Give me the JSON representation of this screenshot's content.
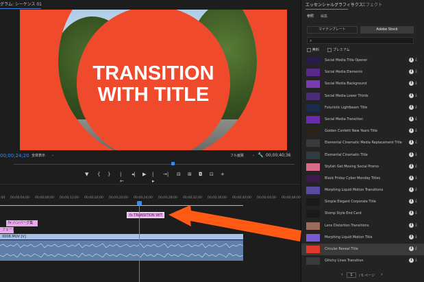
{
  "program": {
    "title": "グラム: シーケンス 01",
    "menu_icon": "≡",
    "video_title": "TRANSITION\nWITH TITLE",
    "timecode_current": "00;00;24;20",
    "fit_label": "全体表示",
    "quality_label": "フル画質",
    "timecode_total": "00;00;40;36",
    "transport": {
      "marker": "▼",
      "in_point": "{",
      "out_point": "}",
      "go_in": "|←",
      "step_back": "◂|",
      "play": "▶",
      "step_fwd": "|▸",
      "go_out": "→|",
      "lift": "⊟",
      "extract": "⊞",
      "export_frame": "◘",
      "compare": "⊡",
      "add": "+"
    }
  },
  "timeline": {
    "ruler_ticks": [
      "00;00;04;00",
      "00;00;08;00",
      "00;00;12;00",
      "00;00;16;00",
      "00;00;20;00",
      "00;00;24;00",
      "00;00;28;00",
      "00;00;32;00",
      "00;00;36;00",
      "00;00;40;00",
      "00;00;44;00",
      "00;00;48;00"
    ],
    "ruler_start": ";00",
    "clip_transition": "fx TRANSITION WIT",
    "clip_hamburg": "fx ハンバーグ集",
    "clip_small": "フェードン",
    "clip_video": "0008.MOV [V]"
  },
  "essential_graphics": {
    "title": "エッセンシャルグラフィックス",
    "menu_icon": "≡",
    "effects_tab": "エフェクト",
    "tab_browse": "参照",
    "tab_edit": "編集",
    "btn_my_templates": "マイテンプレート",
    "btn_adobe_stock": "Adobe Stock",
    "search_icon": "⌕",
    "free_label": "無料",
    "premium_label": "プレミアム",
    "items": [
      {
        "name": "Social Media Title Opener",
        "thumb": "#2a1c4a"
      },
      {
        "name": "Social Media Elements",
        "thumb": "#5a2a8a"
      },
      {
        "name": "Social Media Background",
        "thumb": "#7a3ab0"
      },
      {
        "name": "Social Media Lower Thirds",
        "thumb": "#4a2a7a"
      },
      {
        "name": "Futuristic Lightbeam Title",
        "thumb": "#1a2a4a"
      },
      {
        "name": "Social Media Transition",
        "thumb": "#6a2ab0"
      },
      {
        "name": "Golden Confetti New Years Title",
        "thumb": "#2a2418"
      },
      {
        "name": "Elemental Cinematic Media Replacement Title",
        "thumb": "#3a3a3a"
      },
      {
        "name": "Elemental Cinematic Title",
        "thumb": "#2f3a42"
      },
      {
        "name": "Stylish Get Moving Social Promo",
        "thumb": "#d86a8a"
      },
      {
        "name": "Black Friday Cyber Monday Titles",
        "thumb": "#3a1a4a"
      },
      {
        "name": "Morphing Liquid Motion Transitions",
        "thumb": "#5a4aa0"
      },
      {
        "name": "Simple Elegant Corporate Title",
        "thumb": "#1a1a1a"
      },
      {
        "name": "Stomp Style End Card",
        "thumb": "#1a1a1a"
      },
      {
        "name": "Lens Distortion Transitions",
        "thumb": "#9a6a5a"
      },
      {
        "name": "Morphing Liquid Motion Title",
        "thumb": "#7a5ad0"
      },
      {
        "name": "Circular Reveal Title",
        "thumb": "#e03a2a"
      },
      {
        "name": "Glitchy Lines Transition",
        "thumb": "#3a3a3a"
      }
    ],
    "selected_index": 16,
    "info_icon": "i",
    "cloud_icon": "⤓",
    "page_current": "1",
    "page_total": "/ 5 ページ",
    "prev_icon": "‹",
    "next_icon": "›"
  },
  "colors": {
    "accent": "#3b8be8",
    "video_bg": "#f04a2c",
    "arrow": "#ff5a14"
  }
}
